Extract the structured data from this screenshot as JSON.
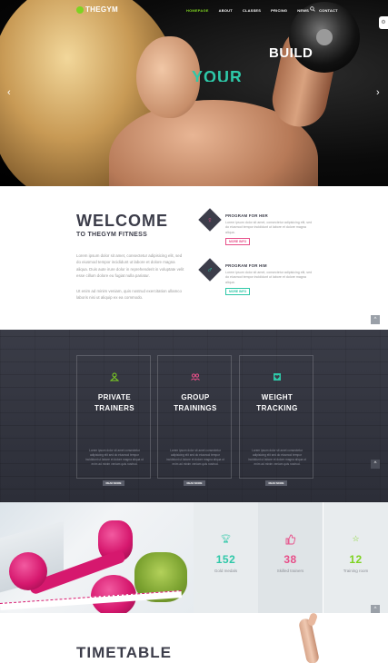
{
  "colors": {
    "accent_green": "#7ed321",
    "accent_teal": "#2ec8a8",
    "accent_pink": "#e74f89",
    "dark": "#3c3d4a"
  },
  "nav": {
    "logo": "THEGYM",
    "links": [
      "HOMEPAGE",
      "ABOUT",
      "CLASSES",
      "PRICING",
      "NEWS",
      "CONTACT"
    ],
    "active": "HOMEPAGE",
    "search_icon": "search-icon"
  },
  "hero": {
    "headline_1": "BUILD",
    "headline_2": "YOUR",
    "prev_arrow": "‹",
    "next_arrow": "›"
  },
  "welcome": {
    "title": "WELCOME",
    "subtitle": "TO THEGYM FITNESS",
    "para_1": "Lorem ipsum dolor sit amet, consectetur adipisicing elit, sed do eiusmod tempor incididunt ut labore et dolore magna aliqua. Duis aute irure dolor in reprehenderit in voluptate velit esse cillum dolore eu fugiat nulla pariatur.",
    "para_2": "Ut enim ad minim veniam, quis nostrud exercitation ullamco laboris nisi ut aliquip ex ea commodo."
  },
  "programs": [
    {
      "title": "PROGRAM FOR HER",
      "text": "Lorem ipsum dolor sit amet, consectetur adipisicing elit, sed do eiusmod tempor incididunt ut labore et dolore magna aliqua.",
      "button": "MORE INFO",
      "icon": "female-icon"
    },
    {
      "title": "PROGRAM FOR HIM",
      "text": "Lorem ipsum dolor sit amet, consectetur adipisicing elit, sed do eiusmod tempor incididunt ut labore et dolore magna aliqua.",
      "button": "MORE INFO",
      "icon": "male-icon"
    }
  ],
  "services": [
    {
      "title_1": "PRIVATE",
      "title_2": "TRAINERS",
      "text": "Lorem ipsum dolor sit amet consectetur adipisicing elit sed do eiusmod tempor incididunt ut labore et dolore magna aliqua ut enim ad minim veniam quis nostrud.",
      "button": "READ MORE",
      "icon": "trainer-icon"
    },
    {
      "title_1": "GROUP",
      "title_2": "TRAININGS",
      "text": "Lorem ipsum dolor sit amet consectetur adipisicing elit sed do eiusmod tempor incididunt ut labore et dolore magna aliqua ut enim ad minim veniam quis nostrud.",
      "button": "READ MORE",
      "icon": "group-icon"
    },
    {
      "title_1": "WEIGHT",
      "title_2": "TRACKING",
      "text": "Lorem ipsum dolor sit amet consectetur adipisicing elit sed do eiusmod tempor incididunt ut labore et dolore magna aliqua ut enim ad minim veniam quis nostrud.",
      "button": "READ MORE",
      "icon": "heart-icon"
    }
  ],
  "stats": [
    {
      "number": "152",
      "label": "Gold medals",
      "icon": "trophy-icon"
    },
    {
      "number": "38",
      "label": "Skilled trainers",
      "icon": "thumbs-up-icon"
    },
    {
      "number": "12",
      "label": "Training room",
      "icon": "star-icon"
    }
  ],
  "timetable": {
    "title": "TIMETABLE"
  },
  "scroll_top_icon": "^"
}
